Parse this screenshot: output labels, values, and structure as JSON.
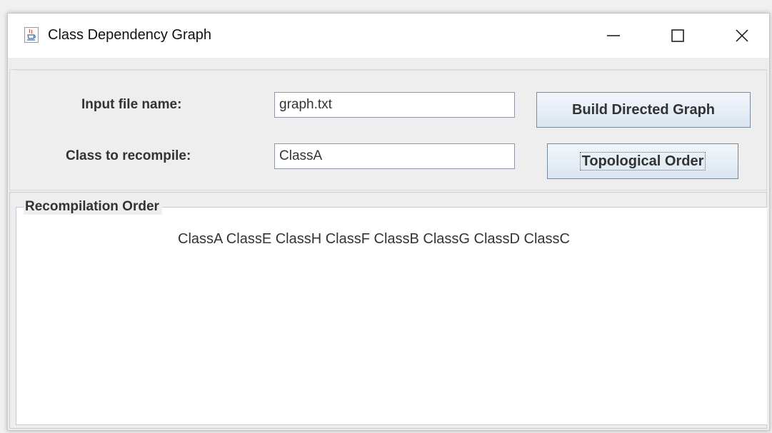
{
  "window": {
    "title": "Class Dependency Graph",
    "icon": "java-cup-icon"
  },
  "form": {
    "file_label": "Input file name:",
    "file_value": "graph.txt",
    "class_label": "Class to recompile:",
    "class_value": "ClassA",
    "build_button": "Build Directed Graph",
    "topo_button": "Topological Order"
  },
  "result": {
    "legend": "Recompilation Order",
    "order": "ClassA ClassE ClassH ClassF ClassB ClassG ClassD ClassC"
  },
  "colors": {
    "button_border": "#7a8a9c",
    "panel_bg": "#eeeeee",
    "text": "#333333"
  }
}
